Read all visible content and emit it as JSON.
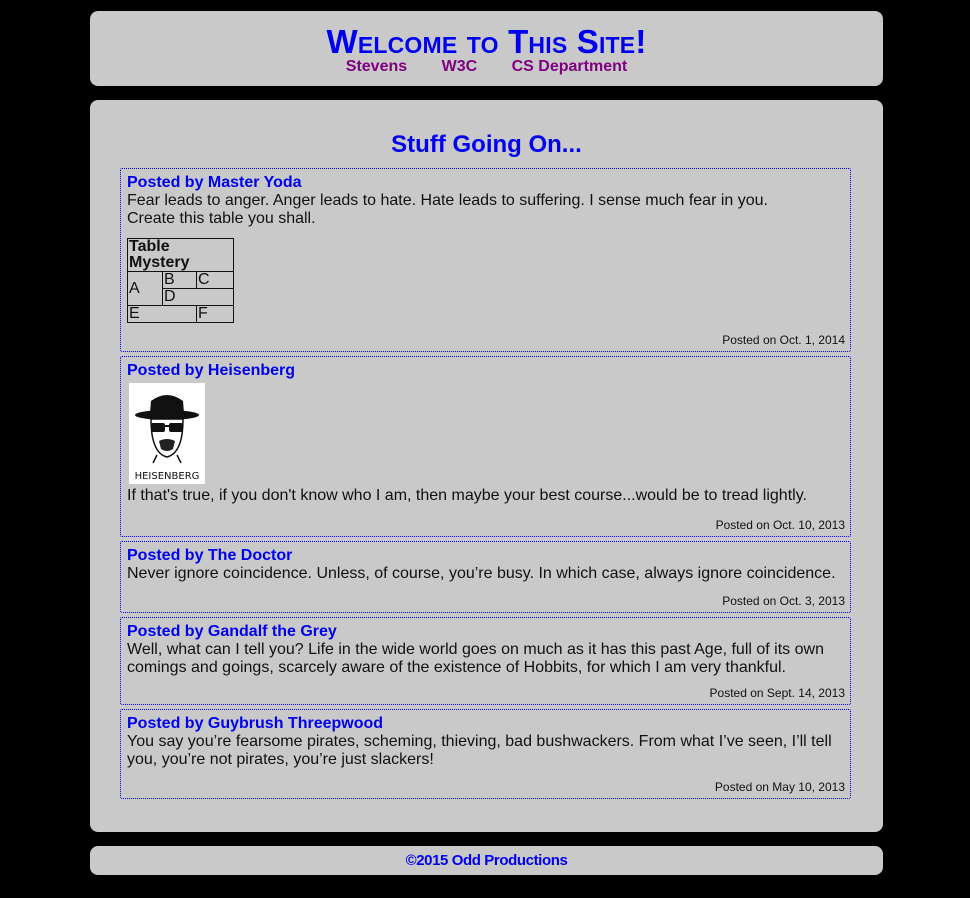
{
  "header": {
    "title": "Welcome to This Site!",
    "nav": [
      "Stevens",
      "W3C",
      "CS Department"
    ]
  },
  "main": {
    "section_title": "Stuff Going On...",
    "posts": [
      {
        "author": "Posted by Master Yoda",
        "lines": [
          "Fear leads to anger. Anger leads to hate. Hate leads to suffering. I sense much fear in you.",
          "Create this table you shall."
        ],
        "table": {
          "caption": "Table Mystery",
          "cells": [
            "A",
            "B",
            "C",
            "D",
            "E",
            "F"
          ]
        },
        "date": "Posted on Oct. 1, 2014"
      },
      {
        "author": "Posted by Heisenberg",
        "image_caption": "HEISENBERG",
        "body": "If that's true, if you don't know who I am, then maybe your best course...would be to tread lightly.",
        "date": "Posted on Oct. 10, 2013"
      },
      {
        "author": "Posted by The Doctor",
        "body": "Never ignore coincidence. Unless, of course, you’re busy. In which case, always ignore coincidence.",
        "date": "Posted on Oct. 3, 2013"
      },
      {
        "author": "Posted by Gandalf the Grey",
        "body": "Well, what can I tell you? Life in the wide world goes on much as it has this past Age, full of its own comings and goings, scarcely aware of the existence of Hobbits, for which I am very thankful.",
        "date": "Posted on Sept. 14, 2013"
      },
      {
        "author": "Posted by Guybrush Threepwood",
        "body": "You say you’re fearsome pirates, scheming, thieving, bad bushwackers. From what I’ve seen, I’ll tell you, you’re not pirates, you’re just slackers!",
        "date": "Posted on May 10, 2013"
      }
    ]
  },
  "footer": {
    "copyright": "©2015 Odd Productions"
  },
  "colors": {
    "background": "#000000",
    "panel": "#c9c9c9",
    "link": "#0000ee",
    "visited": "#800080"
  }
}
